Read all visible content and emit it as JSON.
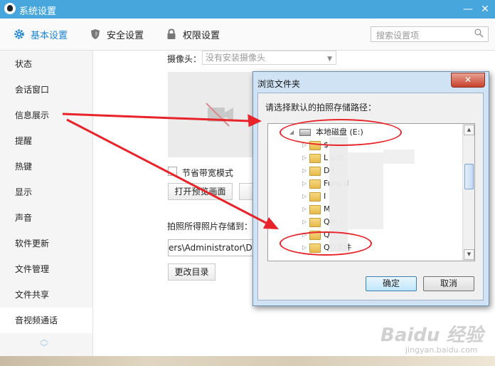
{
  "window": {
    "title": "系统设置",
    "controls": [
      "—",
      "✕"
    ]
  },
  "nav": {
    "tabs": [
      {
        "label": "基本设置",
        "icon": "gear-icon",
        "active": true
      },
      {
        "label": "安全设置",
        "icon": "shield-icon",
        "active": false
      },
      {
        "label": "权限设置",
        "icon": "lock-icon",
        "active": false
      }
    ],
    "search_placeholder": "搜索设置项"
  },
  "sidebar": {
    "items": [
      {
        "label": "状态"
      },
      {
        "label": "会话窗口"
      },
      {
        "label": "信息展示"
      },
      {
        "label": "提醒"
      },
      {
        "label": "热键"
      },
      {
        "label": "显示"
      },
      {
        "label": "声音"
      },
      {
        "label": "软件更新"
      },
      {
        "label": "文件管理"
      },
      {
        "label": "文件共享"
      },
      {
        "label": "音视频通话",
        "active": true
      }
    ],
    "scroll_up": "︿",
    "scroll_down": "﹀"
  },
  "main": {
    "camera_label": "摄像头：",
    "camera_value": "没有安装摄像头",
    "saving_mode_label": "节省带宽模式",
    "preview_button": "打开预览画面",
    "photo_path_label": "拍照所得照片存储到：",
    "photo_path_value": "ers\\Administrator\\Do",
    "change_dir_button": "更改目录"
  },
  "dialog": {
    "title": "浏览文件夹",
    "close": "✕",
    "prompt": "请选择默认的拍照存储路径：",
    "tree": [
      {
        "label": "本地磁盘 (E:)",
        "type": "drive",
        "expander": "◢"
      },
      {
        "label": "$",
        "type": "folder",
        "expander": "▷"
      },
      {
        "label": "L                          ads",
        "type": "folder",
        "expander": "▷"
      },
      {
        "label": "D                             l",
        "type": "folder",
        "expander": "▷"
      },
      {
        "label": "Funs                  d",
        "type": "folder",
        "expander": "▷"
      },
      {
        "label": "I",
        "type": "folder",
        "expander": "▷"
      },
      {
        "label": "M",
        "type": "folder",
        "expander": "▷"
      },
      {
        "label": "Qm                   l",
        "type": "folder",
        "expander": "▷"
      },
      {
        "label": "Q",
        "type": "folder",
        "expander": "▷"
      },
      {
        "label": "QQ文件",
        "type": "folder",
        "expander": "▷"
      }
    ],
    "ok_button": "确定",
    "cancel_button": "取消"
  },
  "watermark": {
    "logo": "Baidu 经验",
    "url": "jingyan.baidu.com"
  },
  "colors": {
    "titlebar": "#47a7dc",
    "active_tab": "#1d86d4",
    "annotation": "#e8242a",
    "dialog_frame": "#cfe3f5"
  }
}
